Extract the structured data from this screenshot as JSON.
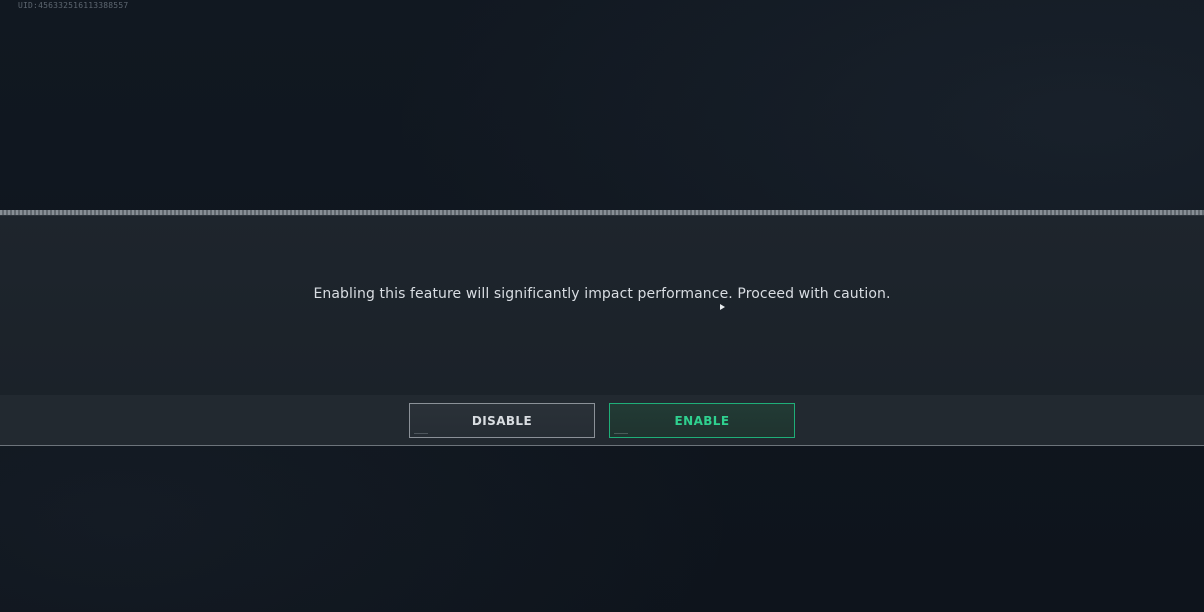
{
  "uid_text": "UID:456332516113388557",
  "dialog": {
    "message": "Enabling this feature will significantly impact performance. Proceed with caution.",
    "buttons": {
      "disable_label": "DISABLE",
      "enable_label": "ENABLE"
    }
  },
  "colors": {
    "background": "#0f151d",
    "panel": "#1e252d",
    "accent_green": "#2fd08f",
    "disable_border": "#8b9198"
  },
  "icons": {
    "cursor": "mouse-pointer-icon"
  }
}
